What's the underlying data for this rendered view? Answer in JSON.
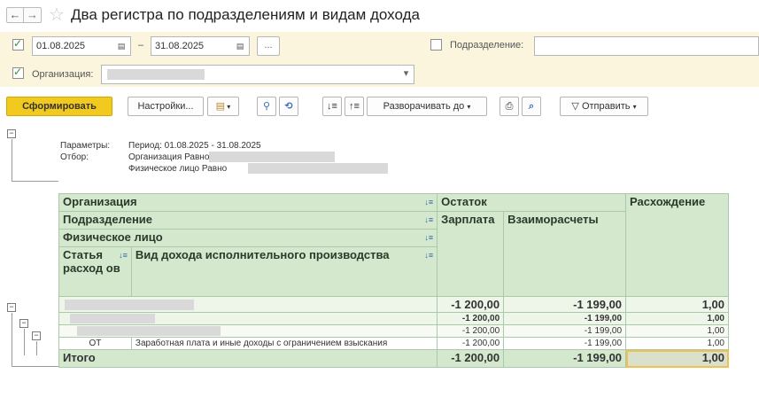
{
  "window": {
    "title": "Два регистра по подразделениям и видам дохода"
  },
  "filters": {
    "period_enabled": true,
    "date_from": "01.08.2025",
    "dash": "–",
    "date_to": "31.08.2025",
    "ellipsis": "...",
    "subdivision_enabled": false,
    "subdivision_label": "Подразделение:",
    "organization_enabled": true,
    "organization_label": "Организация:",
    "dropdown_arrow": "▾"
  },
  "toolbar": {
    "generate_label": "Сформировать",
    "settings_label": "Настройки...",
    "expand_label": "Разворачивать до",
    "send_label": "Отправить",
    "dropdown_arrow": "▾"
  },
  "params": {
    "params_label": "Параметры:",
    "period_text": "Период: 01.08.2025 - 31.08.2025",
    "filter_label": "Отбор:",
    "filter_org": "Организация Равно",
    "filter_person": "Физическое лицо Равно"
  },
  "table": {
    "headers": {
      "organization": "Организация",
      "subdivision": "Подразделение",
      "person": "Физическое лицо",
      "article": "Статья расход ов",
      "income_type": "Вид дохода исполнительного производства",
      "balance": "Остаток",
      "salary": "Зарплата",
      "settlements": "Взаиморасчеты",
      "discrepancy": "Расхождение"
    },
    "rows": [
      {
        "level": 1,
        "article": "",
        "income_type": "",
        "salary": "-1 200,00",
        "settlements": "-1 199,00",
        "discrepancy": "1,00"
      },
      {
        "level": 2,
        "article": "",
        "income_type": "",
        "salary": "-1 200,00",
        "settlements": "-1 199,00",
        "discrepancy": "1,00"
      },
      {
        "level": 3,
        "article": "",
        "income_type": "",
        "salary": "-1 200,00",
        "settlements": "-1 199,00",
        "discrepancy": "1,00"
      },
      {
        "level": 4,
        "article": "ОТ",
        "income_type": "Заработная плата и иные доходы с ограничением взыскания",
        "salary": "-1 200,00",
        "settlements": "-1 199,00",
        "discrepancy": "1,00"
      }
    ],
    "total": {
      "label": "Итого",
      "salary": "-1 200,00",
      "settlements": "-1 199,00",
      "discrepancy": "1,00"
    }
  }
}
